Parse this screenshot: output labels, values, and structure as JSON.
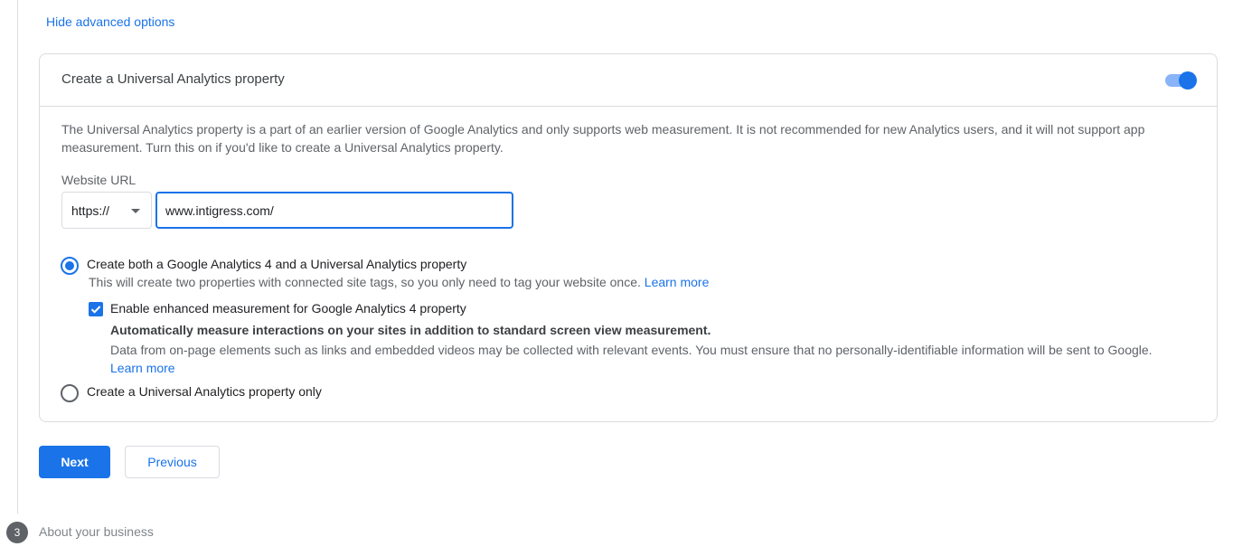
{
  "hide_advanced_label": "Hide advanced options",
  "ua_card": {
    "title": "Create a Universal Analytics property",
    "toggle_on": true,
    "description": "The Universal Analytics property is a part of an earlier version of Google Analytics and only supports web measurement. It is not recommended for new Analytics users, and it will not support app measurement. Turn this on if you'd like to create a Universal Analytics property.",
    "website_url_label": "Website URL",
    "protocol_value": "https://",
    "url_value": "www.intigress.com/",
    "option_both": {
      "label": "Create both a Google Analytics 4 and a Universal Analytics property",
      "sublabel": "This will create two properties with connected site tags, so you only need to tag your website once.",
      "learn_more": "Learn more",
      "selected": true
    },
    "enhanced_measurement": {
      "label": "Enable enhanced measurement for Google Analytics 4 property",
      "checked": true,
      "bold_text": "Automatically measure interactions on your sites in addition to standard screen view measurement.",
      "description": "Data from on-page elements such as links and embedded videos may be collected with relevant events. You must ensure that no personally-identifiable information will be sent to Google.",
      "learn_more": "Learn more"
    },
    "option_ua_only": {
      "label": "Create a Universal Analytics property only",
      "selected": false
    }
  },
  "buttons": {
    "next": "Next",
    "previous": "Previous"
  },
  "next_step": {
    "number": "3",
    "label": "About your business"
  },
  "colors": {
    "accent": "#1a73e8",
    "toggle_track": "#8ab4f8",
    "border": "#dadce0",
    "secondary_text": "#5f6368"
  },
  "icons": {
    "protocol_dropdown": "caret-down-icon",
    "checkbox_mark": "check-icon"
  }
}
